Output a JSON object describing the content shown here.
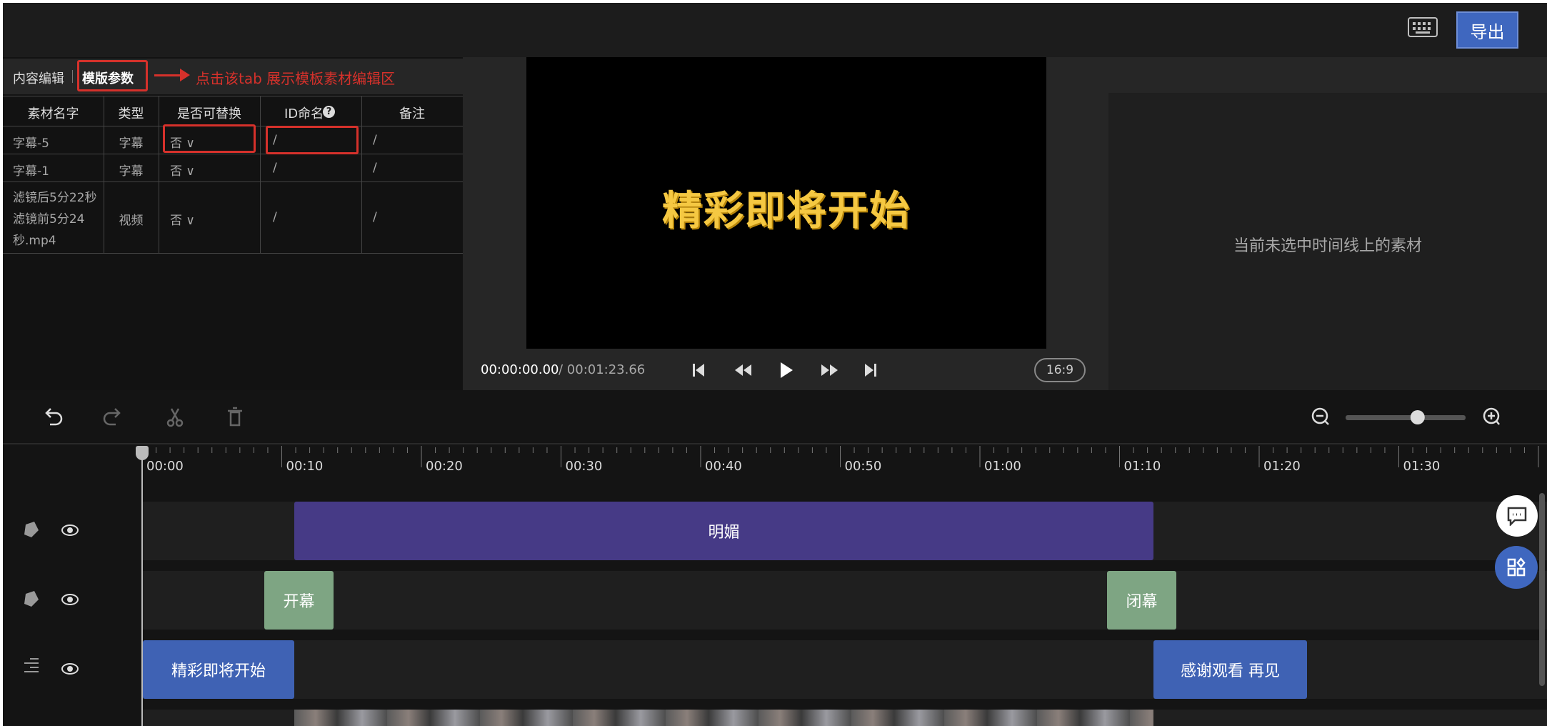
{
  "header": {
    "export_label": "导出",
    "keyboard_icon": "keyboard-icon"
  },
  "left_panel": {
    "tabs": [
      "内容编辑",
      "模版参数"
    ],
    "annotation": "点击该tab 展示模板素材编辑区",
    "columns": [
      "素材名字",
      "类型",
      "是否可替换",
      "ID命名",
      "备注"
    ],
    "rows": [
      {
        "name": "字幕-5",
        "type": "字幕",
        "replaceable": "否",
        "id": "/",
        "note": "/"
      },
      {
        "name": "字幕-1",
        "type": "字幕",
        "replaceable": "否",
        "id": "/",
        "note": "/"
      },
      {
        "name_lines": [
          "滤镜后5分22秒",
          "滤镜前5分24",
          "秒.mp4"
        ],
        "type": "视频",
        "replaceable": "否",
        "id": "/",
        "note": "/"
      }
    ]
  },
  "preview": {
    "caption": "精彩即将开始",
    "current_time": "00:00:00.00",
    "total_time": "/ 00:01:23.66",
    "aspect_ratio": "16:9"
  },
  "properties": {
    "empty_message": "当前未选中时间线上的素材"
  },
  "timeline": {
    "zoom_level": 0.6,
    "ticks": [
      "00:00",
      "00:10",
      "00:20",
      "00:30",
      "00:40",
      "00:50",
      "01:00",
      "01:10",
      "01:20",
      "01:30"
    ],
    "tracks": [
      {
        "icon": "sticker-icon",
        "clips": [
          {
            "label": "明媚",
            "color": "#463a86"
          }
        ]
      },
      {
        "icon": "sticker-icon",
        "clips": [
          {
            "label": "开幕",
            "color": "#7ea583"
          },
          {
            "label": "闭幕",
            "color": "#7ea583"
          }
        ]
      },
      {
        "icon": "text-track-icon",
        "clips": [
          {
            "label": "精彩即将开始",
            "color": "#3f62b4"
          },
          {
            "label": "感谢观看 再见",
            "color": "#3f62b4"
          }
        ]
      }
    ]
  },
  "colors": {
    "accent": "#3f67bf",
    "highlight": "#d6312b",
    "caption": "#f5c842"
  }
}
